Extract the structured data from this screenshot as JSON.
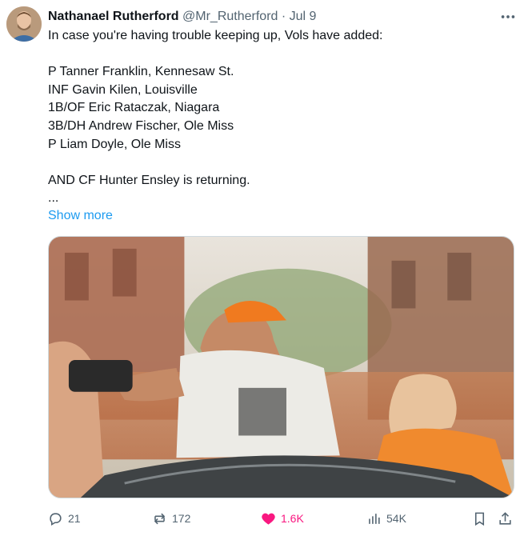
{
  "author": {
    "name": "Nathanael Rutherford",
    "handle": "@Mr_Rutherford",
    "separator": "·",
    "date": "Jul 9"
  },
  "tweet": {
    "lines": [
      "In case you're having trouble keeping up, Vols have added:",
      "",
      "P Tanner Franklin, Kennesaw St.",
      "INF Gavin Kilen, Louisville",
      "1B/OF Eric Rataczak, Niagara",
      "3B/DH Andrew Fischer, Ole Miss",
      "P Liam Doyle, Ole Miss",
      "",
      "AND CF Hunter Ensley is returning.",
      "..."
    ],
    "show_more": "Show more",
    "more_icon": "ellipsis-icon"
  },
  "actions": {
    "replies": "21",
    "reposts": "172",
    "likes": "1.6K",
    "views": "54K",
    "like_color": "#f91880",
    "link_color": "#1d9bf0"
  }
}
